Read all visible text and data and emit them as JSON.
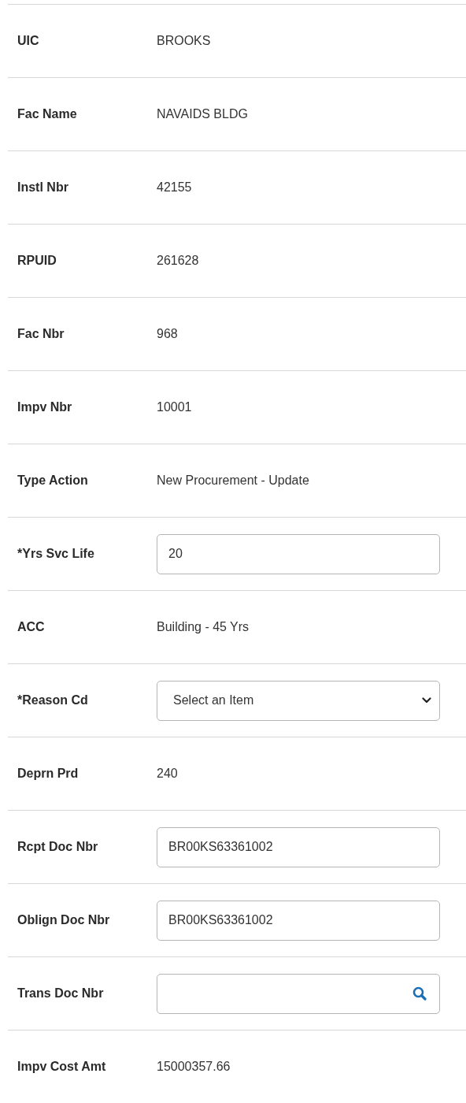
{
  "fields": [
    {
      "label": "UIC",
      "kind": "text",
      "value": "BROOKS"
    },
    {
      "label": "Fac Name",
      "kind": "text",
      "value": "NAVAIDS BLDG"
    },
    {
      "label": "Instl Nbr",
      "kind": "text",
      "value": "42155"
    },
    {
      "label": "RPUID",
      "kind": "text",
      "value": "261628"
    },
    {
      "label": "Fac Nbr",
      "kind": "text",
      "value": "968"
    },
    {
      "label": "Impv Nbr",
      "kind": "text",
      "value": "10001"
    },
    {
      "label": "Type Action",
      "kind": "text",
      "value": "New Procurement - Update"
    },
    {
      "label": "*Yrs Svc Life",
      "kind": "input",
      "value": "20"
    },
    {
      "label": "ACC",
      "kind": "text",
      "value": "Building - 45 Yrs"
    },
    {
      "label": "*Reason Cd",
      "kind": "select",
      "value": "Select an Item"
    },
    {
      "label": "Deprn Prd",
      "kind": "text",
      "value": "240"
    },
    {
      "label": "Rcpt Doc Nbr",
      "kind": "input",
      "value": "BR00KS63361002"
    },
    {
      "label": "Oblign Doc Nbr",
      "kind": "input",
      "value": "BR00KS63361002"
    },
    {
      "label": "Trans Doc Nbr",
      "kind": "search"
    },
    {
      "label": "Impv Cost Amt",
      "kind": "text",
      "value": "15000357.66"
    }
  ]
}
